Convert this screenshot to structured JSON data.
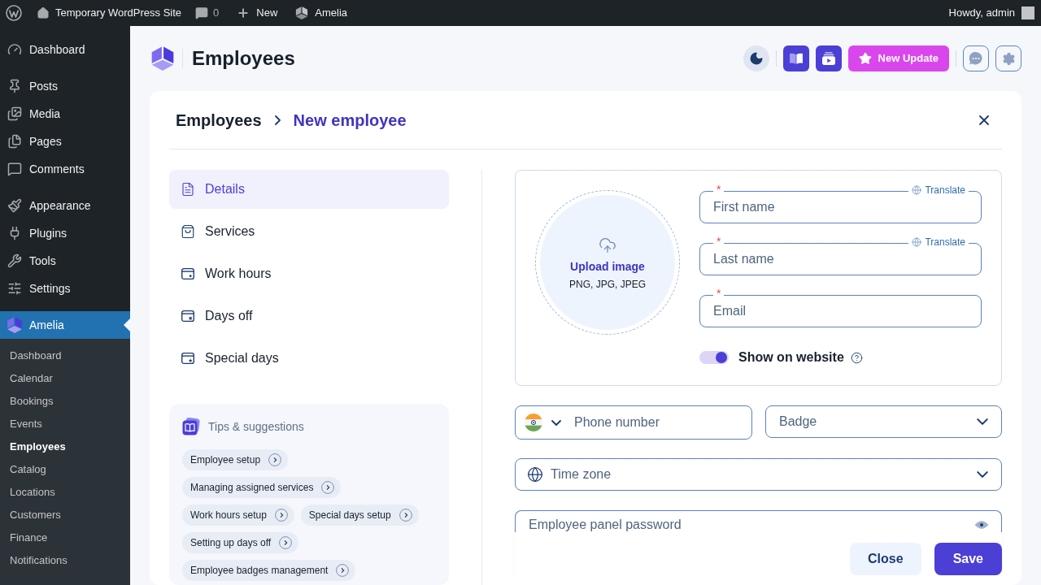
{
  "admin_bar": {
    "site_name": "Temporary WordPress Site",
    "comments_count": "0",
    "new_label": "New",
    "plugin_label": "Amelia",
    "greeting": "Howdy, admin"
  },
  "sidebar": {
    "groups": [
      {
        "items": [
          {
            "label": "Dashboard",
            "selected": false
          }
        ]
      },
      {
        "items": [
          {
            "label": "Posts",
            "selected": false
          },
          {
            "label": "Media",
            "selected": false
          },
          {
            "label": "Pages",
            "selected": false
          },
          {
            "label": "Comments",
            "selected": false
          }
        ]
      },
      {
        "items": [
          {
            "label": "Appearance",
            "selected": false
          },
          {
            "label": "Plugins",
            "selected": false
          },
          {
            "label": "Tools",
            "selected": false
          },
          {
            "label": "Settings",
            "selected": false
          }
        ]
      },
      {
        "items": [
          {
            "label": "Amelia",
            "selected": true
          }
        ]
      }
    ],
    "submenu": [
      {
        "label": "Dashboard",
        "selected": false
      },
      {
        "label": "Calendar",
        "selected": false
      },
      {
        "label": "Bookings",
        "selected": false
      },
      {
        "label": "Events",
        "selected": false
      },
      {
        "label": "Employees",
        "selected": true
      },
      {
        "label": "Catalog",
        "selected": false
      },
      {
        "label": "Locations",
        "selected": false
      },
      {
        "label": "Customers",
        "selected": false
      },
      {
        "label": "Finance",
        "selected": false
      },
      {
        "label": "Notifications",
        "selected": false
      }
    ]
  },
  "page_header": {
    "title": "Employees",
    "new_update_label": "New Update"
  },
  "breadcrumb": [
    {
      "label": "Employees",
      "current": false
    },
    {
      "label": "New employee",
      "current": true
    }
  ],
  "detail_tabs": [
    {
      "label": "Details",
      "selected": true
    },
    {
      "label": "Services",
      "selected": false
    },
    {
      "label": "Work hours",
      "selected": false
    },
    {
      "label": "Days off",
      "selected": false
    },
    {
      "label": "Special days",
      "selected": false
    }
  ],
  "tips": {
    "title": "Tips & suggestions",
    "chips": [
      "Employee setup",
      "Managing assigned services",
      "Work hours setup",
      "Special days setup",
      "Setting up days off",
      "Employee badges management"
    ]
  },
  "form": {
    "upload": {
      "title": "Upload image",
      "formats": "PNG, JPG, JPEG"
    },
    "name_fields": [
      {
        "placeholder": "First name",
        "required_mark": "*",
        "translate_label": "Translate"
      },
      {
        "placeholder": "Last name",
        "required_mark": "*",
        "translate_label": "Translate"
      },
      {
        "placeholder": "Email",
        "required_mark": "*"
      }
    ],
    "show_on_website": {
      "label": "Show on website",
      "on": true
    },
    "phone": {
      "placeholder": "Phone number"
    },
    "badge": {
      "placeholder": "Badge"
    },
    "time_zone": {
      "placeholder": "Time zone"
    },
    "password": {
      "placeholder": "Employee panel password"
    }
  },
  "footer_buttons": [
    {
      "label": "Close",
      "kind": "secondary"
    },
    {
      "label": "Save",
      "kind": "primary"
    }
  ]
}
